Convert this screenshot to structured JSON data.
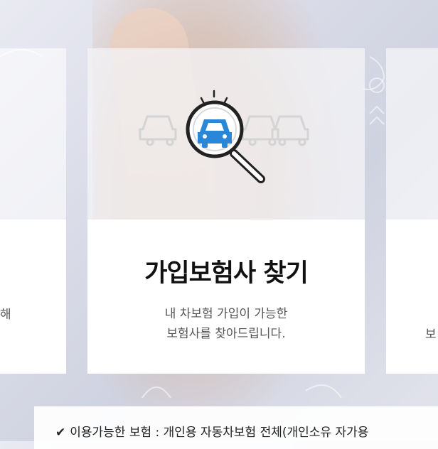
{
  "main_card": {
    "title": "가입보험사 찾기",
    "desc_line1": "내 차보험 가입이 가능한",
    "desc_line2": "보험사를 찾아드립니다."
  },
  "left_card": {
    "text_fragment": "해"
  },
  "right_card": {
    "text_fragment": "보"
  },
  "info_bar": {
    "check_icon": "✔",
    "text": "이용가능한 보험 : 개인용 자동차보험 전체(개인소유 자가용"
  },
  "colors": {
    "accent_blue": "#2a86d6",
    "outline_dark": "#222222",
    "car_outline": "#d8d8d8"
  }
}
